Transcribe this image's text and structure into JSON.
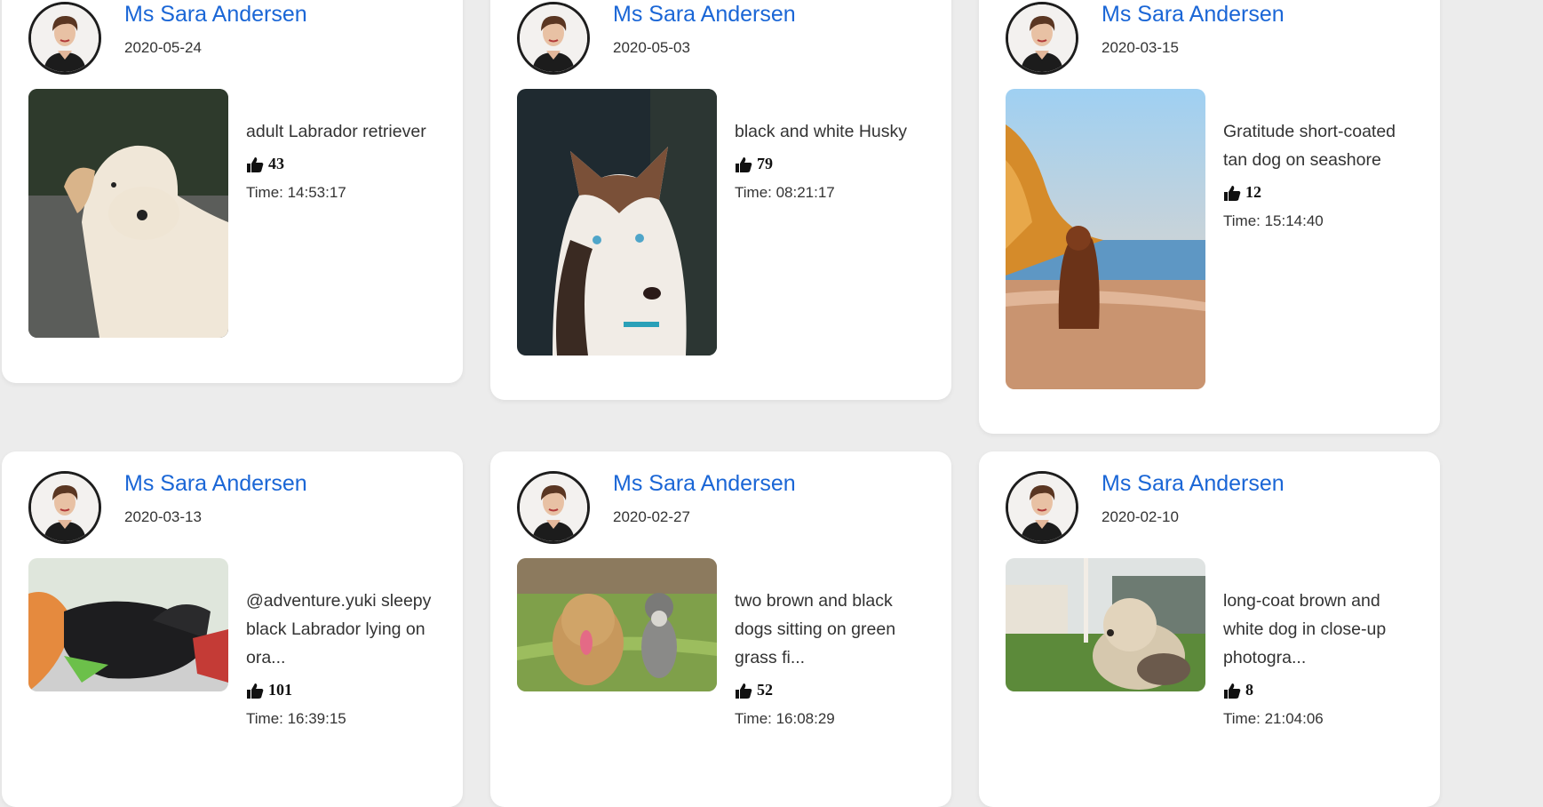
{
  "icons": {
    "like": "thumbs-up-icon"
  },
  "colors": {
    "author": "#1a66d6",
    "background": "#ececec",
    "card": "#ffffff"
  },
  "posts": [
    {
      "author": "Ms Sara Andersen",
      "date": "2020-05-24",
      "description": "adult Labrador retriever",
      "likes": "43",
      "time": "Time: 14:53:17"
    },
    {
      "author": "Ms Sara Andersen",
      "date": "2020-05-03",
      "description": "black and white Husky",
      "likes": "79",
      "time": "Time: 08:21:17"
    },
    {
      "author": "Ms Sara Andersen",
      "date": "2020-03-15",
      "description": "Gratitude short-coated tan dog on seashore",
      "likes": "12",
      "time": "Time: 15:14:40"
    },
    {
      "author": "Ms Sara Andersen",
      "date": "2020-03-13",
      "description": "@adventure.yuki sleepy black Labrador lying on ora...",
      "likes": "101",
      "time": "Time: 16:39:15"
    },
    {
      "author": "Ms Sara Andersen",
      "date": "2020-02-27",
      "description": "two brown and black dogs sitting on green grass fi...",
      "likes": "52",
      "time": "Time: 16:08:29"
    },
    {
      "author": "Ms Sara Andersen",
      "date": "2020-02-10",
      "description": "long-coat brown and white dog in close-up photogra...",
      "likes": "8",
      "time": "Time: 21:04:06"
    }
  ]
}
